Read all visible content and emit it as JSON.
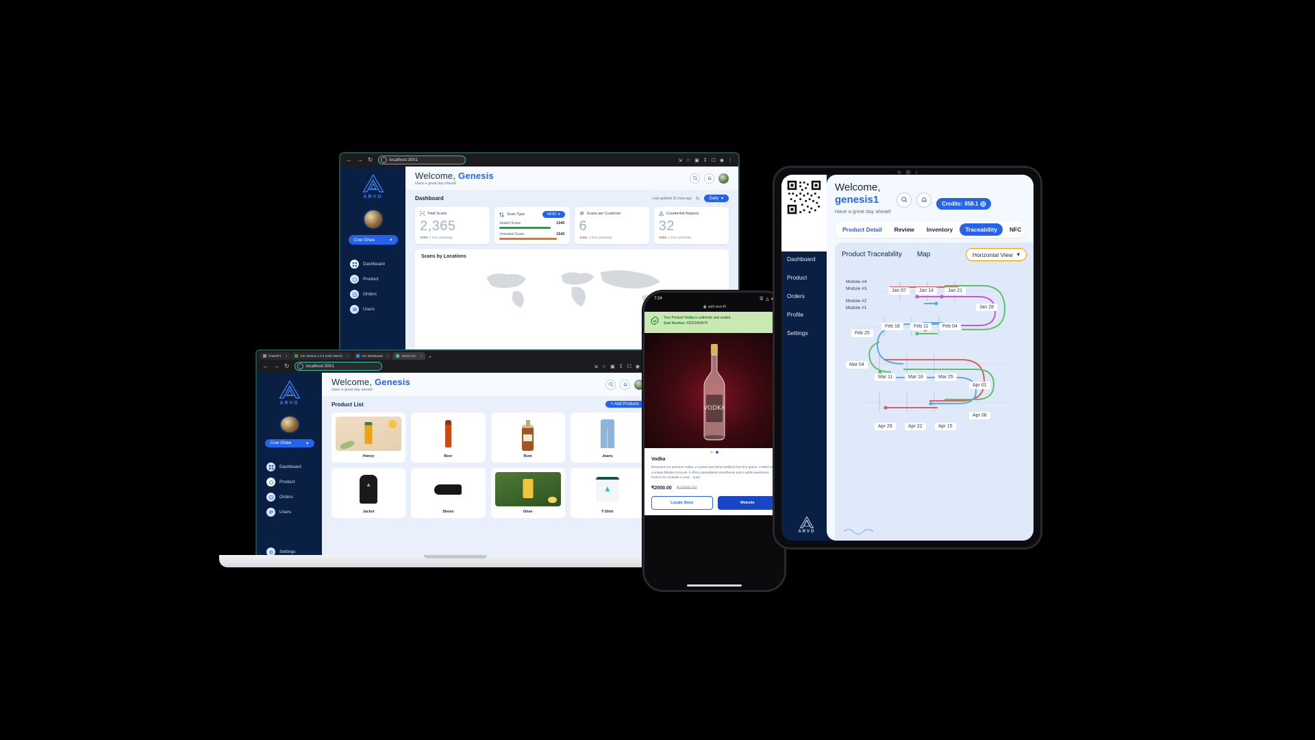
{
  "brand": {
    "name": "ARVO",
    "accent": "#2563eb",
    "dark": "#0a1f44"
  },
  "desktop": {
    "browser": {
      "url": "localhost:3001"
    },
    "sidebar": {
      "logo_text": "ARVO",
      "product_pill": "Cow Ghee",
      "items": [
        {
          "label": "Dashboard",
          "icon": "dashboard-icon",
          "active": true
        },
        {
          "label": "Product",
          "icon": "product-icon",
          "active": false
        },
        {
          "label": "Orders",
          "icon": "orders-icon",
          "active": false
        },
        {
          "label": "Users",
          "icon": "users-icon",
          "active": false
        }
      ]
    },
    "header": {
      "welcome": "Welcome, ",
      "user": "Genesis",
      "subtitle": "Have a great day ahead!"
    },
    "dashboard": {
      "title": "Dashboard",
      "last_updated": "Last updated 32 mins ago",
      "range": "Daily",
      "cards": [
        {
          "label": "Total Scans",
          "value": "2,365",
          "delta": "+21%",
          "delta_dir": "pos",
          "delta_text": "↗ from yesterday"
        },
        {
          "label": "Scan Type",
          "badge": "RFID",
          "rows": [
            {
              "label": "Sealed Scans",
              "value": "1345"
            },
            {
              "label": "Unsealed Scans",
              "value": "1542"
            }
          ]
        },
        {
          "label": "Scans per Customer",
          "value": "6",
          "delta": "-9.2%",
          "delta_dir": "neg",
          "delta_text": "↘ from yesterday"
        },
        {
          "label": "Counterfeit Reports",
          "value": "32",
          "delta": "-9.8%",
          "delta_dir": "neg",
          "delta_text": "↘ from yesterday"
        }
      ],
      "locations_title": "Scans by Locations"
    }
  },
  "laptop": {
    "tabs": [
      {
        "label": "ChatGPT",
        "color": "#8e9097",
        "active": false
      },
      {
        "label": "AIC Version 1.0.3 (12th March)",
        "color": "#2ea043",
        "active": false
      },
      {
        "label": "AIC Dashboard",
        "color": "#3b82f6",
        "active": false
      },
      {
        "label": "ARVO AIC",
        "color": "#2ec4b6",
        "active": true
      }
    ],
    "browser": {
      "url": "localhost:3001"
    },
    "header": {
      "welcome": "Welcome, ",
      "user": "Genesis",
      "subtitle": "Have a great day ahead!"
    },
    "sidebar": {
      "logo_text": "ARVO",
      "product_pill": "Cow Ghee",
      "items": [
        {
          "label": "Dashboard",
          "icon": "dashboard-icon",
          "active": false
        },
        {
          "label": "Product",
          "icon": "product-icon",
          "active": true
        },
        {
          "label": "Orders",
          "icon": "orders-icon",
          "active": false
        },
        {
          "label": "Users",
          "icon": "users-icon",
          "active": false
        },
        {
          "label": "Settings",
          "icon": "gear-icon",
          "active": false
        }
      ]
    },
    "product_list": {
      "title": "Product List",
      "add_button": "+ Add Products",
      "products": [
        {
          "name": "Honey",
          "kind": "honey"
        },
        {
          "name": "Beer",
          "kind": "beer"
        },
        {
          "name": "Rum",
          "kind": "rum"
        },
        {
          "name": "Jeans",
          "kind": "jeans"
        },
        {
          "name": "Jacket",
          "kind": "jacket"
        },
        {
          "name": "Shoes",
          "kind": "shoes"
        },
        {
          "name": "Ghee",
          "kind": "ghee"
        },
        {
          "name": "T-Shirt",
          "kind": "tshirt"
        }
      ]
    }
  },
  "phone": {
    "status": {
      "time": "7:24",
      "url": "auth.arvo.fit"
    },
    "banner": {
      "prefix": "Your Product ",
      "product": "Vodka",
      "suffix": " is authentic and sealed.",
      "seal_label": "Seal Number:",
      "seal_number": "02021454575"
    },
    "product": {
      "title": "Vodka",
      "description": "Discover4 our premium vodka: a crystal-clear blend distilled from fine grains. Crafted with a unique filtration process, it offers unparalleled smoothness and a subtle sweetness. Perfect for cocktails or neat...",
      "more": "more",
      "price": "₹2000.00",
      "old_price": "₹2899.00"
    },
    "buttons": {
      "secondary": "Locate Store",
      "primary": "Website"
    }
  },
  "tablet": {
    "header": {
      "welcome": "Welcome,",
      "user": "genesis1",
      "subtitle": "Have a great day ahead!"
    },
    "credits": {
      "label": "Credits:",
      "value": "858.1"
    },
    "tabs": [
      {
        "label": "Product Detail",
        "active": false,
        "blue": true
      },
      {
        "label": "Review",
        "active": false
      },
      {
        "label": "Inventory",
        "active": false
      },
      {
        "label": "Traceability",
        "active": true
      },
      {
        "label": "NFC",
        "active": false
      }
    ],
    "sidebar": {
      "logo_text": "ARVO",
      "items": [
        "Dashboard",
        "Product",
        "Orders",
        "Profile",
        "Settings"
      ]
    },
    "panel": {
      "title": "Product Traceability",
      "map_label": "Map",
      "view": "Horizontal View"
    },
    "chart_data": {
      "type": "timeline",
      "title": "Product Traceability",
      "modules": [
        "Module #4",
        "Module #3",
        "Module #2",
        "Module #1"
      ],
      "dates": [
        "Jan 07",
        "Jan 14",
        "Jan 21",
        "Jan 28",
        "Feb 04",
        "Feb 11",
        "Feb 18",
        "Feb 25",
        "Mar 04",
        "Mar 11",
        "Mar 18",
        "Mar 25",
        "Apr 01",
        "Apr 08",
        "Apr 15",
        "Apr 22",
        "Apr 29"
      ],
      "series": [
        {
          "name": "Module #1",
          "color": "#e05c5c"
        },
        {
          "name": "Module #2",
          "color": "#c855d8"
        },
        {
          "name": "Module #3",
          "color": "#5aa9e0"
        },
        {
          "name": "Module #4",
          "color": "#5fbf6a"
        }
      ],
      "legend_position": "left",
      "grid": true
    }
  }
}
